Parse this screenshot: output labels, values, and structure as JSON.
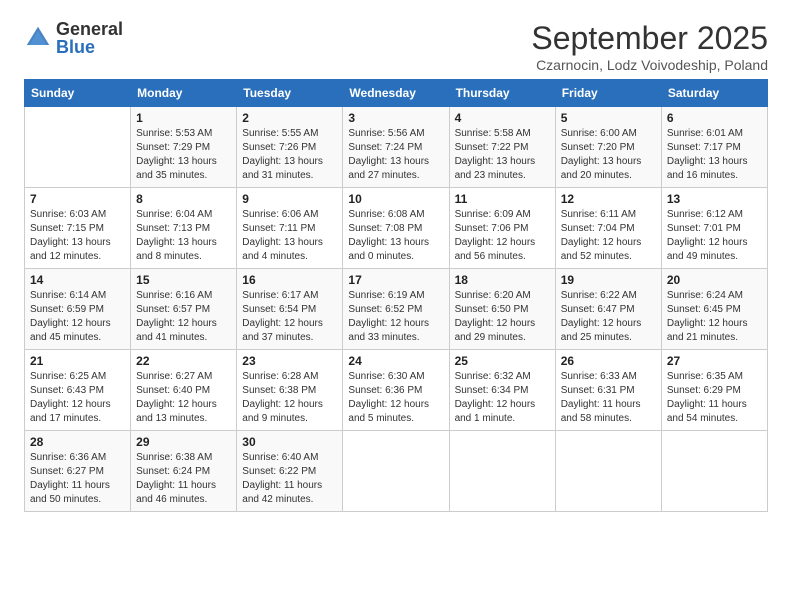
{
  "logo": {
    "general": "General",
    "blue": "Blue"
  },
  "title": "September 2025",
  "subtitle": "Czarnocin, Lodz Voivodeship, Poland",
  "weekdays": [
    "Sunday",
    "Monday",
    "Tuesday",
    "Wednesday",
    "Thursday",
    "Friday",
    "Saturday"
  ],
  "weeks": [
    [
      {
        "day": "",
        "info": ""
      },
      {
        "day": "1",
        "info": "Sunrise: 5:53 AM\nSunset: 7:29 PM\nDaylight: 13 hours\nand 35 minutes."
      },
      {
        "day": "2",
        "info": "Sunrise: 5:55 AM\nSunset: 7:26 PM\nDaylight: 13 hours\nand 31 minutes."
      },
      {
        "day": "3",
        "info": "Sunrise: 5:56 AM\nSunset: 7:24 PM\nDaylight: 13 hours\nand 27 minutes."
      },
      {
        "day": "4",
        "info": "Sunrise: 5:58 AM\nSunset: 7:22 PM\nDaylight: 13 hours\nand 23 minutes."
      },
      {
        "day": "5",
        "info": "Sunrise: 6:00 AM\nSunset: 7:20 PM\nDaylight: 13 hours\nand 20 minutes."
      },
      {
        "day": "6",
        "info": "Sunrise: 6:01 AM\nSunset: 7:17 PM\nDaylight: 13 hours\nand 16 minutes."
      }
    ],
    [
      {
        "day": "7",
        "info": "Sunrise: 6:03 AM\nSunset: 7:15 PM\nDaylight: 13 hours\nand 12 minutes."
      },
      {
        "day": "8",
        "info": "Sunrise: 6:04 AM\nSunset: 7:13 PM\nDaylight: 13 hours\nand 8 minutes."
      },
      {
        "day": "9",
        "info": "Sunrise: 6:06 AM\nSunset: 7:11 PM\nDaylight: 13 hours\nand 4 minutes."
      },
      {
        "day": "10",
        "info": "Sunrise: 6:08 AM\nSunset: 7:08 PM\nDaylight: 13 hours\nand 0 minutes."
      },
      {
        "day": "11",
        "info": "Sunrise: 6:09 AM\nSunset: 7:06 PM\nDaylight: 12 hours\nand 56 minutes."
      },
      {
        "day": "12",
        "info": "Sunrise: 6:11 AM\nSunset: 7:04 PM\nDaylight: 12 hours\nand 52 minutes."
      },
      {
        "day": "13",
        "info": "Sunrise: 6:12 AM\nSunset: 7:01 PM\nDaylight: 12 hours\nand 49 minutes."
      }
    ],
    [
      {
        "day": "14",
        "info": "Sunrise: 6:14 AM\nSunset: 6:59 PM\nDaylight: 12 hours\nand 45 minutes."
      },
      {
        "day": "15",
        "info": "Sunrise: 6:16 AM\nSunset: 6:57 PM\nDaylight: 12 hours\nand 41 minutes."
      },
      {
        "day": "16",
        "info": "Sunrise: 6:17 AM\nSunset: 6:54 PM\nDaylight: 12 hours\nand 37 minutes."
      },
      {
        "day": "17",
        "info": "Sunrise: 6:19 AM\nSunset: 6:52 PM\nDaylight: 12 hours\nand 33 minutes."
      },
      {
        "day": "18",
        "info": "Sunrise: 6:20 AM\nSunset: 6:50 PM\nDaylight: 12 hours\nand 29 minutes."
      },
      {
        "day": "19",
        "info": "Sunrise: 6:22 AM\nSunset: 6:47 PM\nDaylight: 12 hours\nand 25 minutes."
      },
      {
        "day": "20",
        "info": "Sunrise: 6:24 AM\nSunset: 6:45 PM\nDaylight: 12 hours\nand 21 minutes."
      }
    ],
    [
      {
        "day": "21",
        "info": "Sunrise: 6:25 AM\nSunset: 6:43 PM\nDaylight: 12 hours\nand 17 minutes."
      },
      {
        "day": "22",
        "info": "Sunrise: 6:27 AM\nSunset: 6:40 PM\nDaylight: 12 hours\nand 13 minutes."
      },
      {
        "day": "23",
        "info": "Sunrise: 6:28 AM\nSunset: 6:38 PM\nDaylight: 12 hours\nand 9 minutes."
      },
      {
        "day": "24",
        "info": "Sunrise: 6:30 AM\nSunset: 6:36 PM\nDaylight: 12 hours\nand 5 minutes."
      },
      {
        "day": "25",
        "info": "Sunrise: 6:32 AM\nSunset: 6:34 PM\nDaylight: 12 hours\nand 1 minute."
      },
      {
        "day": "26",
        "info": "Sunrise: 6:33 AM\nSunset: 6:31 PM\nDaylight: 11 hours\nand 58 minutes."
      },
      {
        "day": "27",
        "info": "Sunrise: 6:35 AM\nSunset: 6:29 PM\nDaylight: 11 hours\nand 54 minutes."
      }
    ],
    [
      {
        "day": "28",
        "info": "Sunrise: 6:36 AM\nSunset: 6:27 PM\nDaylight: 11 hours\nand 50 minutes."
      },
      {
        "day": "29",
        "info": "Sunrise: 6:38 AM\nSunset: 6:24 PM\nDaylight: 11 hours\nand 46 minutes."
      },
      {
        "day": "30",
        "info": "Sunrise: 6:40 AM\nSunset: 6:22 PM\nDaylight: 11 hours\nand 42 minutes."
      },
      {
        "day": "",
        "info": ""
      },
      {
        "day": "",
        "info": ""
      },
      {
        "day": "",
        "info": ""
      },
      {
        "day": "",
        "info": ""
      }
    ]
  ]
}
